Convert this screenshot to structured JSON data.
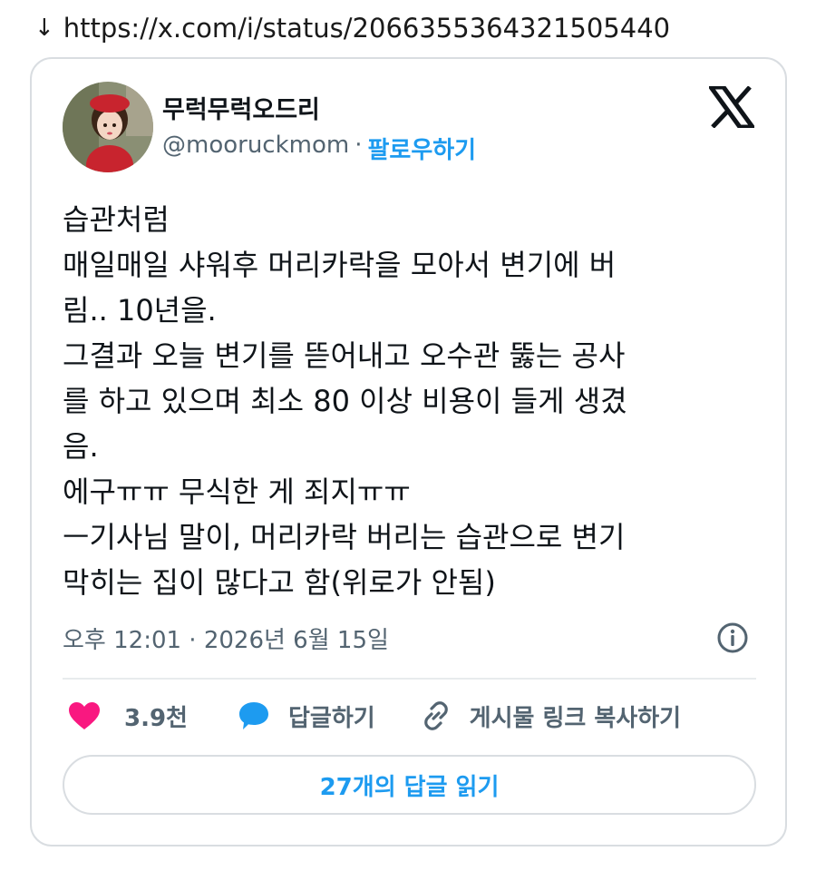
{
  "url_bar": {
    "arrow": "↓",
    "url": "https://x.com/i/status/2066355364321505440"
  },
  "tweet": {
    "author_name": "무럭무럭오드리",
    "handle": "@mooruckmom",
    "separator": "·",
    "follow_label": "팔로우하기",
    "text_lines": [
      "습관처럼",
      "매일매일 샤워후 머리카락을 모아서 변기에 버",
      "림.. 10년을.",
      "그결과 오늘 변기를 뜯어내고 오수관 뚫는 공사",
      "를 하고 있으며 최소 80 이상 비용이 들게 생겼",
      "음.",
      "에구ㅠㅠ 무식한 게 죄지ㅠㅠ",
      "ㅡ기사님 말이, 머리카락 버리는 습관으로 변기",
      "막히는 집이 많다고 함(위로가 안됨)"
    ],
    "timestamp": "오후 12:01 · 2026년 6월 15일"
  },
  "actions": {
    "like_count": "3.9천",
    "reply_label": "답글하기",
    "copy_link_label": "게시물 링크 복사하기"
  },
  "read_replies_label": "27개의 답글 읽기",
  "icons": {
    "x_logo": "x-logo-icon",
    "info": "info-icon",
    "heart": "heart-icon",
    "reply": "speech-bubble-icon",
    "link": "link-icon"
  },
  "colors": {
    "accent_blue": "#1d9bf0",
    "heart_pink": "#f91880",
    "muted_text": "#536471",
    "primary_text": "#0f1419",
    "border": "#d9dde1"
  }
}
